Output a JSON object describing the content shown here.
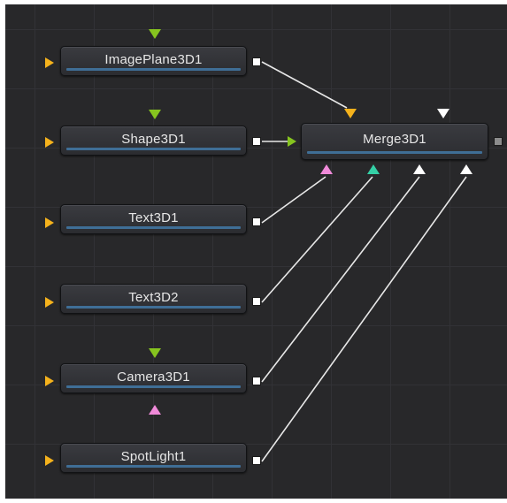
{
  "nodes": {
    "image_plane": {
      "label": "ImagePlane3D1"
    },
    "shape": {
      "label": "Shape3D1"
    },
    "text1": {
      "label": "Text3D1"
    },
    "text2": {
      "label": "Text3D2"
    },
    "camera": {
      "label": "Camera3D1"
    },
    "spotlight": {
      "label": "SpotLight1"
    },
    "merge": {
      "label": "Merge3D1"
    }
  },
  "colors": {
    "background_input": "#f5b21c",
    "foreground_input": "#86c41f",
    "material_input": "#f08ad9",
    "scene_input": "#34d0a6",
    "scene_input_generic": "#ffffff",
    "output": "#ffffff",
    "node_bar": "#3f6e96"
  },
  "icons": {
    "input": "triangle-input-icon",
    "output": "square-output-icon"
  }
}
